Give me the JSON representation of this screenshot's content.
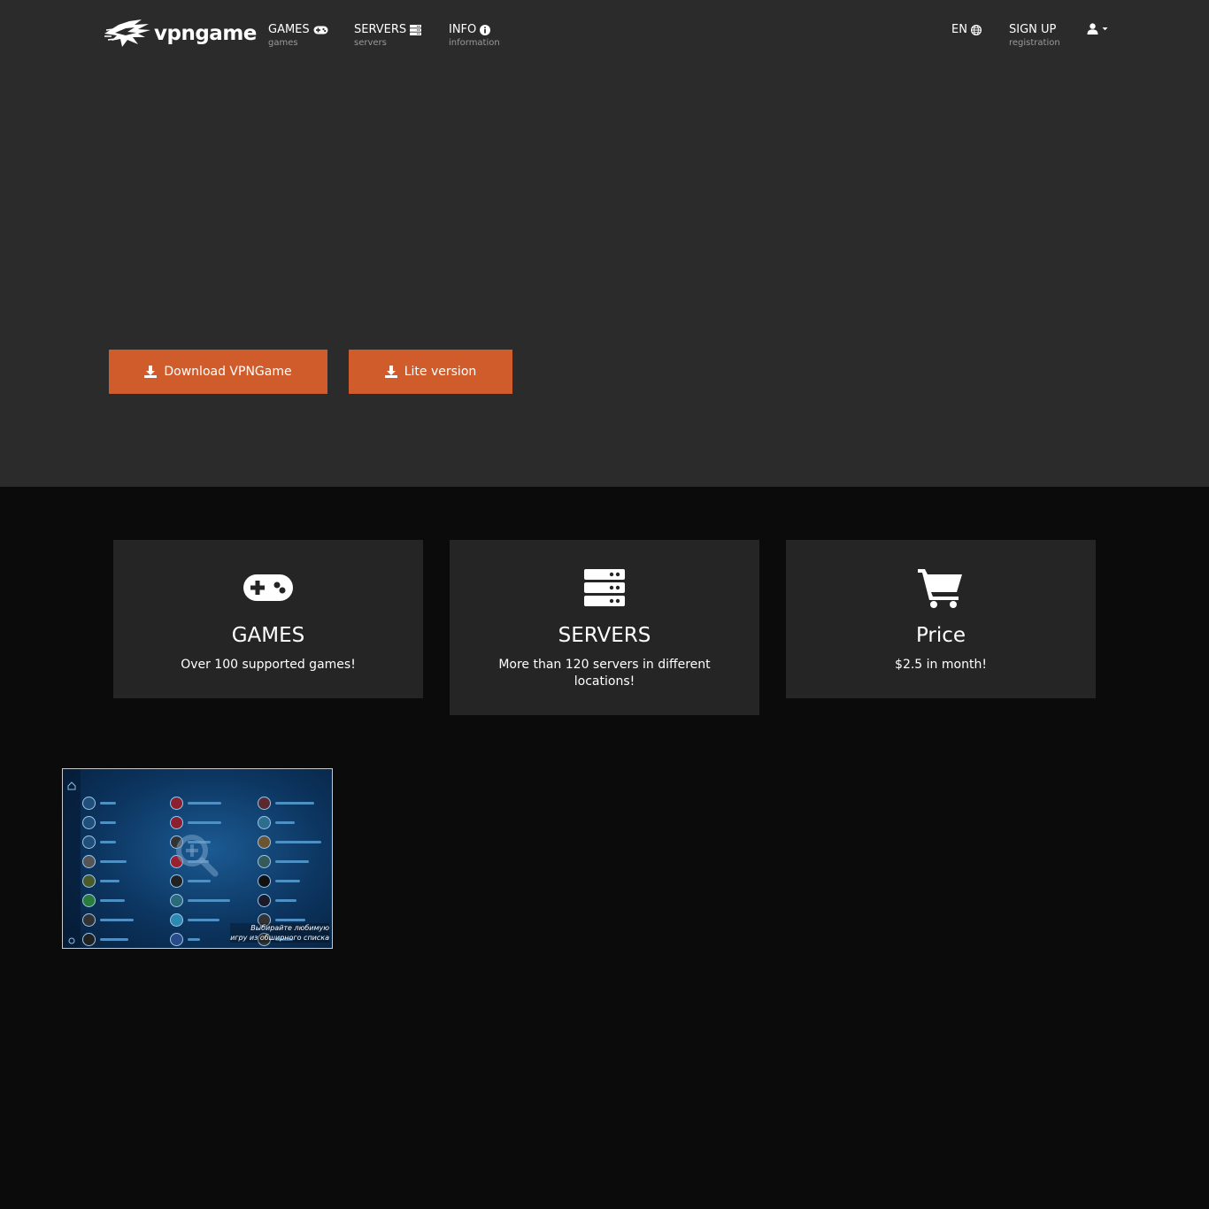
{
  "brand": {
    "name": "vpngame"
  },
  "nav": {
    "games": {
      "label": "GAMES",
      "sub": "games"
    },
    "servers": {
      "label": "SERVERS",
      "sub": "servers"
    },
    "info": {
      "label": "INFO",
      "sub": "information"
    },
    "lang": {
      "label": "EN"
    },
    "signup": {
      "label": "SIGN UP",
      "sub": "registration"
    }
  },
  "hero": {
    "download_label": "Download VPNGame",
    "lite_label": "Lite version"
  },
  "features": [
    {
      "icon": "gamepad-icon",
      "title": "GAMES",
      "desc": "Over 100 supported games!"
    },
    {
      "icon": "server-icon",
      "title": "SERVERS",
      "desc": "More than 120 servers in different locations!"
    },
    {
      "icon": "cart-icon",
      "title": "Price",
      "desc": "$2.5 in month!"
    }
  ],
  "screenshot": {
    "caption_line1": "Выбирайте любимую",
    "caption_line2": "игру из обширного списка"
  },
  "colors": {
    "hero_bg": "#2b2b2b",
    "page_bg": "#0b0b0b",
    "card_bg": "#252525",
    "accent": "#cf5c2a",
    "nav_sub": "#9a9a9a"
  }
}
